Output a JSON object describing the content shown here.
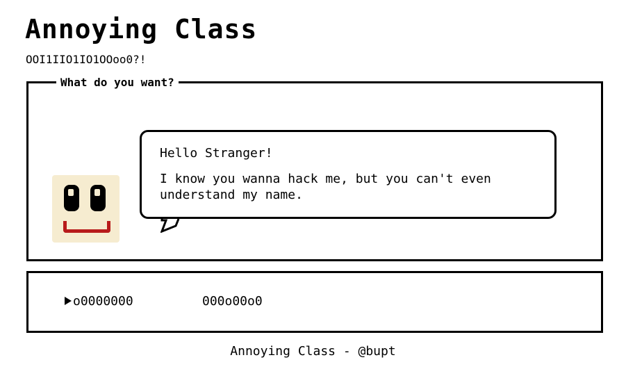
{
  "header": {
    "title": "Annoying Class",
    "subtitle": "OOI1IIO1IO1OOoo0?!"
  },
  "dialog": {
    "legend": "What do you want?",
    "avatar_icon": "smiley-face-icon",
    "greeting": "Hello Stranger!",
    "message": "I know you wanna hack me, but you can't even understand my name."
  },
  "options": {
    "selector_icon": "triangle-right-icon",
    "items": [
      {
        "label": "o0000000"
      },
      {
        "label": "000o00o0"
      }
    ]
  },
  "footer": {
    "text": "Annoying Class - @bupt"
  },
  "colors": {
    "background": "#ffffff",
    "border": "#000000",
    "face": "#f6ecd0",
    "mouth": "#b81b1b"
  }
}
